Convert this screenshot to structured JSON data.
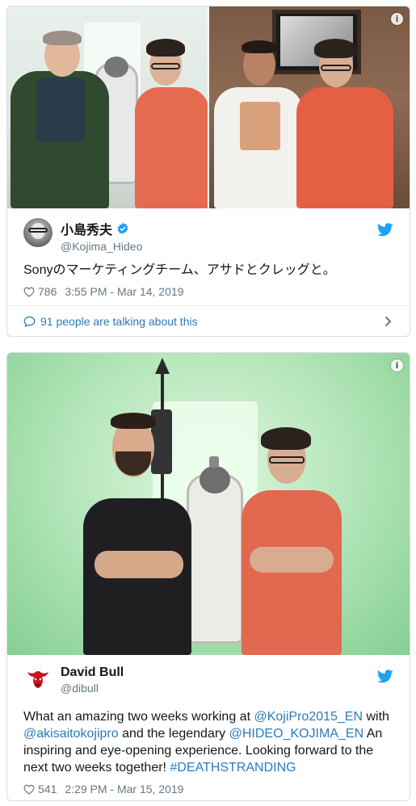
{
  "tweets": [
    {
      "display_name": "小島秀夫",
      "screen_name": "@Kojima_Hideo",
      "text": "Sonyのマーケティングチーム、アサドとクレッグと。",
      "likes": "786",
      "timestamp": "3:55 PM - Mar 14, 2019",
      "talking": "91 people are talking about this",
      "verified": true,
      "photos": 2,
      "avatar_icon": "kojima-avatar"
    },
    {
      "display_name": "David Bull",
      "screen_name": "@dibull",
      "text_parts": [
        "What an amazing two weeks working at ",
        "@KojiPro2015_EN",
        " with ",
        "@akisaitokojipro",
        " and the legendary ",
        "@HIDEO_KOJIMA_EN",
        " An inspiring and eye-opening experience. Looking forward to the next two weeks together! ",
        "#DEATHSTRANDING"
      ],
      "likes": "541",
      "timestamp": "2:29 PM - Mar 15, 2019",
      "verified": false,
      "photos": 1,
      "avatar_icon": "red-bull-avatar"
    }
  ],
  "colors": {
    "link": "#2b7bb9",
    "twitter_blue": "#1da1f2",
    "muted": "#657786",
    "border": "#d8dfe5"
  },
  "icons": [
    "info-icon",
    "verified-badge-icon",
    "twitter-bird-icon",
    "heart-icon",
    "comment-bubble-icon",
    "chevron-right-icon"
  ]
}
